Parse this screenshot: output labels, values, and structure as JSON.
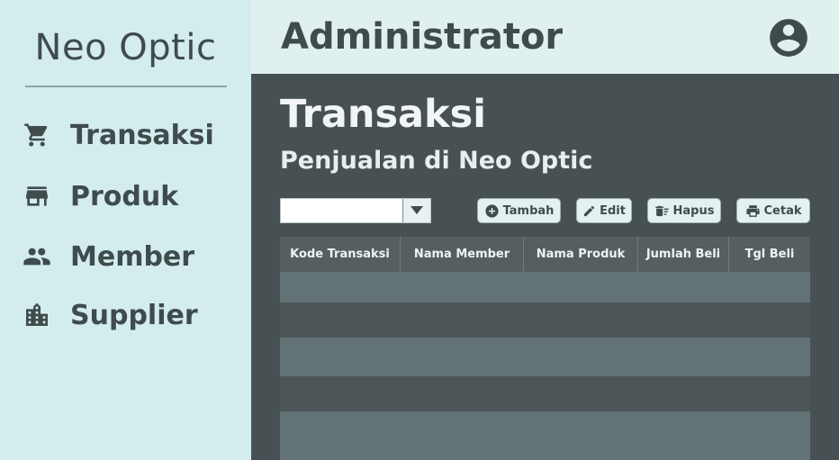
{
  "sidebar": {
    "brand": "Neo Optic",
    "items": [
      {
        "label": "Transaksi",
        "icon": "cart-icon"
      },
      {
        "label": "Produk",
        "icon": "store-icon"
      },
      {
        "label": "Member",
        "icon": "people-icon"
      },
      {
        "label": "Supplier",
        "icon": "building-icon"
      }
    ]
  },
  "header": {
    "title": "Administrator",
    "avatar_icon": "account-circle-icon"
  },
  "main": {
    "title": "Transaksi",
    "subtitle": "Penjualan di Neo Optic",
    "filter": {
      "value": ""
    },
    "buttons": {
      "add": "Tambah",
      "edit": "Edit",
      "delete": "Hapus",
      "print": "Cetak"
    },
    "table": {
      "columns": [
        "Kode Transaksi",
        "Nama Member",
        "Nama Produk",
        "Jumlah Beli",
        "Tgl Beli"
      ],
      "rows": []
    }
  },
  "colors": {
    "sidebar_bg": "#d3edec",
    "header_bg": "#e0f0ef",
    "main_bg": "#475053",
    "row_light": "#637375",
    "row_dark": "#4c5557",
    "text_dark": "#3f4b4d"
  }
}
